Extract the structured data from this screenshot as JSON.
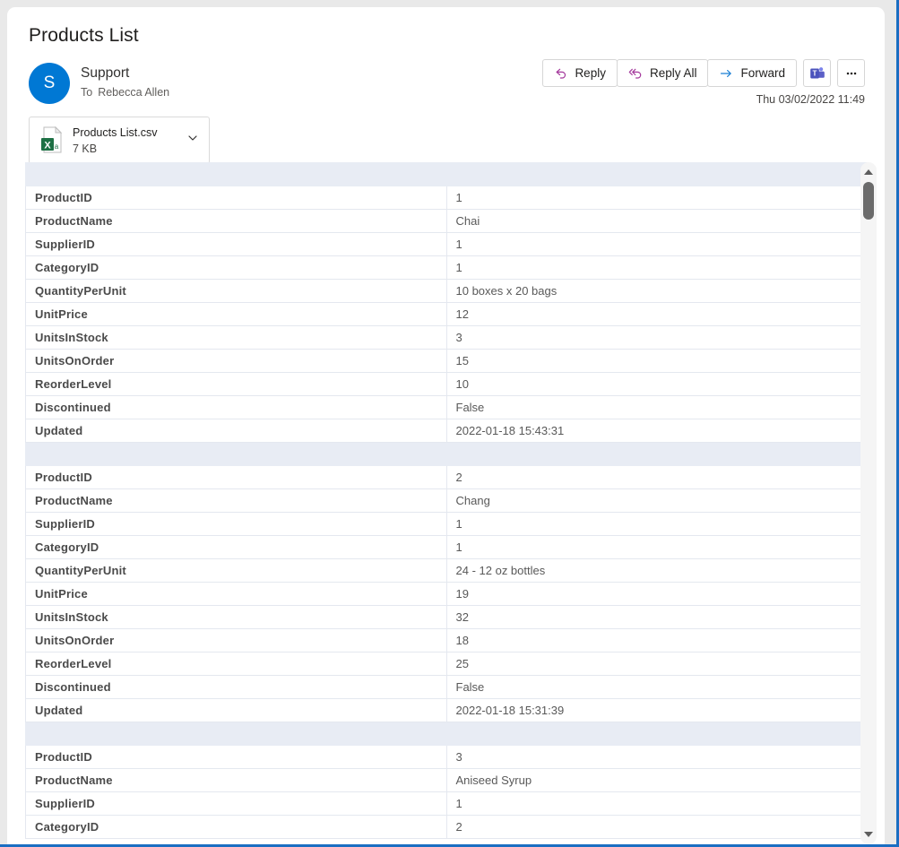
{
  "message": {
    "subject": "Products List",
    "sender_initial": "S",
    "sender_name": "Support",
    "to_label": "To",
    "recipient": "Rebecca Allen",
    "timestamp": "Thu 03/02/2022 11:49",
    "avatar_color": "#0078d4"
  },
  "toolbar": {
    "reply_label": "Reply",
    "reply_all_label": "Reply All",
    "forward_label": "Forward",
    "teams_icon": "teams-icon",
    "more_label": "•••",
    "reply_icon_color": "#a4399c",
    "forward_icon_color": "#1a7fd4"
  },
  "attachment": {
    "file_name": "Products List.csv",
    "file_size": "7 KB",
    "icon": "excel-csv-file-icon",
    "caret_icon": "chevron-down-icon"
  },
  "scrollbar": {
    "up_icon": "scroll-up-arrow-icon",
    "down_icon": "scroll-down-arrow-icon",
    "thumb": "scrollbar-thumb"
  },
  "table": {
    "field_labels": {
      "product_id": "ProductID",
      "product_name": "ProductName",
      "supplier_id": "SupplierID",
      "category_id": "CategoryID",
      "quantity_per_unit": "QuantityPerUnit",
      "unit_price": "UnitPrice",
      "units_in_stock": "UnitsInStock",
      "units_on_order": "UnitsOnOrder",
      "reorder_level": "ReorderLevel",
      "discontinued": "Discontinued",
      "updated": "Updated"
    },
    "records": [
      {
        "ProductID": "1",
        "ProductName": "Chai",
        "SupplierID": "1",
        "CategoryID": "1",
        "QuantityPerUnit": "10 boxes x 20 bags",
        "UnitPrice": "12",
        "UnitsInStock": "3",
        "UnitsOnOrder": "15",
        "ReorderLevel": "10",
        "Discontinued": "False",
        "Updated": "2022-01-18 15:43:31"
      },
      {
        "ProductID": "2",
        "ProductName": "Chang",
        "SupplierID": "1",
        "CategoryID": "1",
        "QuantityPerUnit": "24 - 12 oz bottles",
        "UnitPrice": "19",
        "UnitsInStock": "32",
        "UnitsOnOrder": "18",
        "ReorderLevel": "25",
        "Discontinued": "False",
        "Updated": "2022-01-18 15:31:39"
      },
      {
        "ProductID": "3",
        "ProductName": "Aniseed Syrup",
        "SupplierID": "1",
        "CategoryID": "2"
      }
    ]
  }
}
